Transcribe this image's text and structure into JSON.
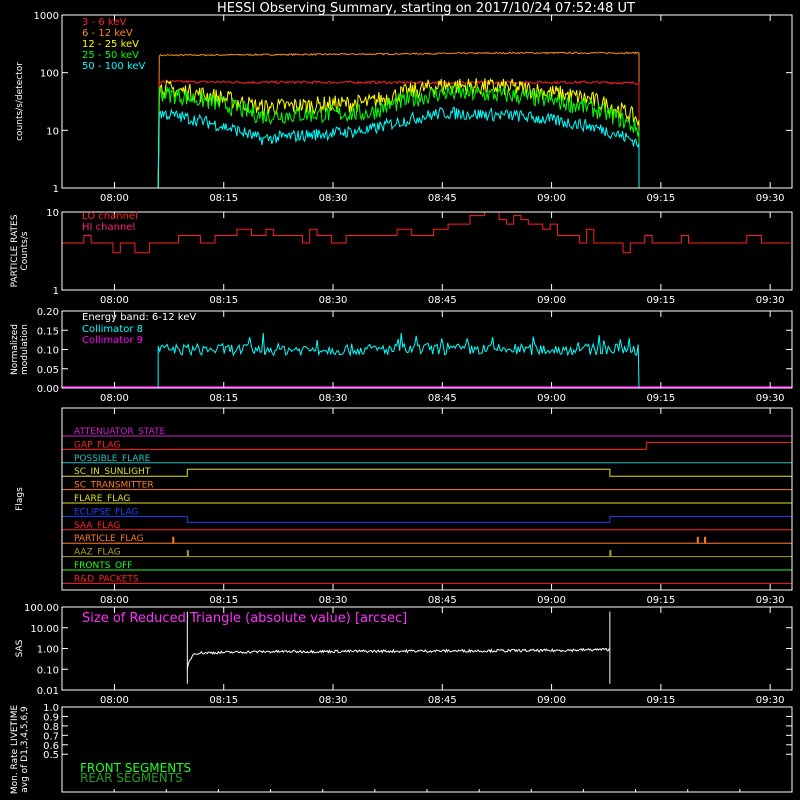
{
  "title": "HESSI Observing Summary, starting on 2017/10/24 07:52:48 UT",
  "time_axis": {
    "start": "07:52:48",
    "end": "09:33:00",
    "labels": [
      "08:00",
      "08:15",
      "08:30",
      "08:45",
      "09:00",
      "09:15",
      "09:30"
    ]
  },
  "chart_data": [
    {
      "type": "line",
      "id": "count_rates",
      "ylabel": "counts/s/detector",
      "yscale": "log",
      "ylim": [
        1,
        1000
      ],
      "ytick_labels": [
        "1",
        "10",
        "100",
        "1000"
      ],
      "x": [
        "07:52:48",
        "08:06",
        "08:06",
        "08:20",
        "08:35",
        "08:45",
        "08:55",
        "09:05",
        "09:12",
        "09:12",
        "09:33"
      ],
      "series": [
        {
          "name": "3 - 6 keV",
          "color": "#ff2020",
          "values": [
            1,
            1,
            70,
            68,
            68,
            67,
            68,
            68,
            66,
            1,
            1
          ]
        },
        {
          "name": "6 - 12 keV",
          "color": "#ff8c1a",
          "values": [
            1,
            1,
            200,
            205,
            210,
            215,
            220,
            220,
            220,
            1,
            1
          ]
        },
        {
          "name": "12 - 25 keV",
          "color": "#ffff00",
          "values": [
            1,
            1,
            55,
            25,
            30,
            60,
            55,
            35,
            15,
            1,
            1
          ]
        },
        {
          "name": "25 - 50 keV",
          "color": "#00ff00",
          "values": [
            1,
            1,
            45,
            18,
            20,
            45,
            40,
            25,
            10,
            1,
            1
          ]
        },
        {
          "name": "50 - 100 keV",
          "color": "#00ffff",
          "values": [
            1,
            1,
            20,
            7,
            10,
            20,
            18,
            12,
            6,
            1,
            1
          ]
        }
      ]
    },
    {
      "type": "line",
      "id": "particle_rates",
      "ylabel": "PARTICLE RATES Counts/s",
      "yscale": "log",
      "ylim": [
        1,
        10
      ],
      "ytick_labels": [
        "1",
        "10"
      ],
      "x": [
        "07:52:48",
        "08:05",
        "08:15",
        "08:25",
        "08:35",
        "08:45",
        "08:50",
        "09:00",
        "09:10",
        "09:20",
        "09:33"
      ],
      "series": [
        {
          "name": "LO channel",
          "color": "#ff2020",
          "values": [
            4,
            4,
            5,
            5,
            5,
            6,
            10,
            6,
            4,
            4,
            4
          ]
        },
        {
          "name": "HI channel",
          "color": "#ff2070",
          "values": []
        }
      ]
    },
    {
      "type": "line",
      "id": "modulation",
      "ylabel": "Normalized modulation",
      "ylim": [
        0,
        0.2
      ],
      "ytick_labels": [
        "0.00",
        "0.05",
        "0.10",
        "0.15",
        "0.20"
      ],
      "annotation": "Energy band: 6-12 keV",
      "x": [
        "07:52:48",
        "08:06",
        "08:06",
        "09:12",
        "09:12",
        "09:33"
      ],
      "series": [
        {
          "name": "Collimator 8",
          "color": "#00ffff",
          "values": [
            0,
            0,
            0.1,
            0.1,
            0,
            0
          ]
        },
        {
          "name": "Collimator 9",
          "color": "#ff00ff",
          "values": [
            0,
            0,
            0,
            0,
            0,
            0
          ]
        }
      ]
    },
    {
      "type": "line",
      "id": "flags",
      "ylabel": "Flags",
      "series": [
        {
          "name": "ATTENUATOR_STATE",
          "color": "#cc22cc",
          "steps": []
        },
        {
          "name": "GAP_FLAG",
          "color": "#ff2020",
          "steps": [
            [
              "09:13",
              "09:33"
            ]
          ]
        },
        {
          "name": "POSSIBLE_FLARE",
          "color": "#20c0c0",
          "steps": []
        },
        {
          "name": "SC_IN_SUNLIGHT",
          "color": "#e0e020",
          "steps": [
            [
              "08:10",
              "09:08"
            ]
          ]
        },
        {
          "name": "SC_TRANSMITTER",
          "color": "#ff7a20",
          "steps": []
        },
        {
          "name": "FLARE_FLAG",
          "color": "#e0e020",
          "steps": []
        },
        {
          "name": "ECLIPSE_FLAG",
          "color": "#2040ff",
          "inverse": true,
          "steps": [
            [
              "08:10",
              "09:08"
            ]
          ]
        },
        {
          "name": "SAA_FLAG",
          "color": "#ff2020",
          "steps": []
        },
        {
          "name": "PARTICLE_FLAG",
          "color": "#ff7a20",
          "spikes": [
            "08:08",
            "09:20",
            "09:21"
          ]
        },
        {
          "name": "AAZ_FLAG",
          "color": "#b0a020",
          "spikes": [
            "08:10",
            "09:08"
          ]
        },
        {
          "name": "FRONTS_OFF",
          "color": "#20ff20",
          "steps": []
        },
        {
          "name": "R&D_PACKETS",
          "color": "#ff2020",
          "steps": []
        }
      ]
    },
    {
      "type": "line",
      "id": "sas",
      "ylabel": "SAS",
      "yscale": "log",
      "ylim": [
        0.01,
        100
      ],
      "ytick_labels": [
        "0.01",
        "0.10",
        "1.00",
        "10.00",
        "100.00"
      ],
      "x": [
        "08:10",
        "08:11",
        "08:20",
        "08:40",
        "09:00",
        "09:08"
      ],
      "series": [
        {
          "name": "Size of Reduced Triangle (absolute value) [arcsec]",
          "color": "#ffffff",
          "values": [
            0.1,
            0.6,
            0.7,
            0.75,
            0.8,
            0.9
          ]
        }
      ]
    },
    {
      "type": "line",
      "id": "livetime",
      "ylabel": "Mon. Rate LIVETIME avg of D1,3,4,5,6,9",
      "ylim": [
        0.1,
        1.0
      ],
      "ytick_labels": [
        "0.5",
        "0.6",
        "0.7",
        "0.8",
        "0.9",
        "1.0"
      ],
      "series": [
        {
          "name": "FRONT SEGMENTS",
          "color": "#20ff20",
          "values": []
        },
        {
          "name": "REAR SEGMENTS",
          "color": "#20a020",
          "values": []
        }
      ]
    }
  ]
}
